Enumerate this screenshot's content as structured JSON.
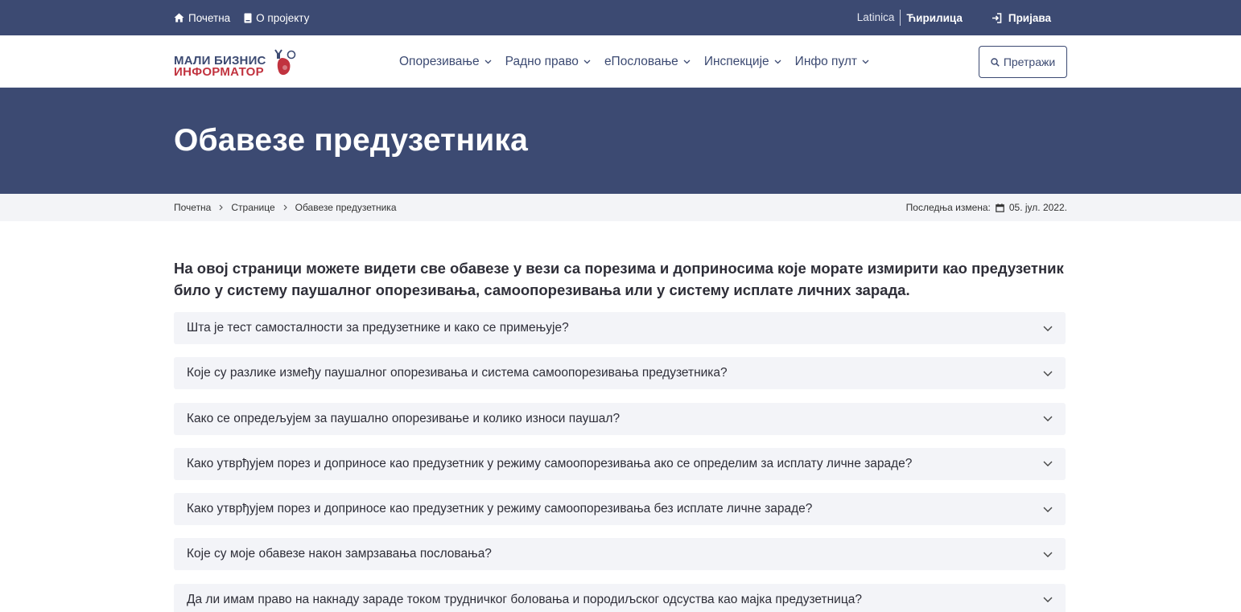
{
  "topbar": {
    "home": "Почетна",
    "about": "О пројекту",
    "lang_latin": "Latinica",
    "lang_cyrillic": "Ћирилица",
    "login": "Пријава"
  },
  "logo": {
    "line1": "МАЛИ БИЗНИС",
    "line2": "ИНФОРМАТОР"
  },
  "menu": [
    {
      "label": "Опорезивање"
    },
    {
      "label": "Радно право"
    },
    {
      "label": "еПословање"
    },
    {
      "label": "Инспекције"
    },
    {
      "label": "Инфо пулт"
    }
  ],
  "search_label": "Претражи",
  "page_title": "Обавезе предузетника",
  "breadcrumb": [
    "Почетна",
    "Странице",
    "Обавезе предузетника"
  ],
  "last_modified_label": "Последња измена:",
  "last_modified_date": "05. јул. 2022.",
  "lead": "На овој страници можете видети све обавезе у вези са порезима и доприносима које морате измирити као предузетник било у систему паушалног опорезивања, самоопорезивања или у систему исплате личних зарада.",
  "faq": [
    "Шта је тест самосталности за предузетнике и како се примењује?",
    "Које су разлике између паушалног опорезивања и система самоопорезивања предузетника?",
    "Како се опредељујем за паушално опорезивање и колико износи паушал?",
    "Како утврђујем порез и доприносе као предузетник у режиму самоопорезивања ако се определим за исплату личне зараде?",
    "Како утврђујем порез и доприносе као предузетник у режиму самоопорезивања без исплате личне зараде?",
    "Које су моје обавезе након замрзавања пословања?",
    "Да ли имам право на накнаду зараде током трудничког боловања и породиљског одсуства као мајка предузетница?"
  ],
  "colors": {
    "brand_navy": "#3c4a72",
    "brand_red": "#c1333f",
    "accordion_bg": "#f3f4f8"
  }
}
